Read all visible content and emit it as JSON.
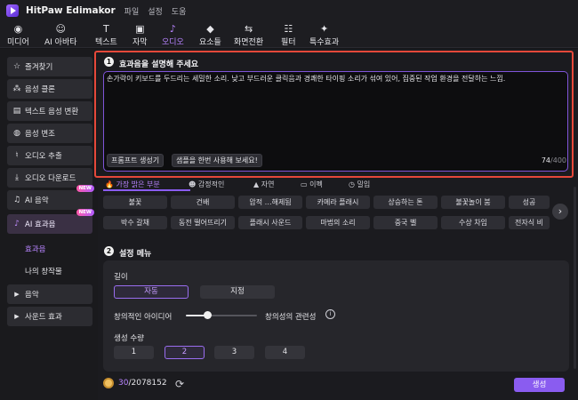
{
  "app": {
    "name": "HitPaw Edimakor",
    "menu": [
      "파일",
      "설정",
      "도움"
    ]
  },
  "toolbar": {
    "items": [
      {
        "label": "미디어",
        "icon": "media-icon"
      },
      {
        "label": "AI 아바타",
        "icon": "avatar-icon"
      },
      {
        "label": "텍스트",
        "icon": "text-icon"
      },
      {
        "label": "자막",
        "icon": "subtitle-icon"
      },
      {
        "label": "오디오",
        "icon": "audio-icon"
      },
      {
        "label": "요소들",
        "icon": "elements-icon"
      },
      {
        "label": "화면전환",
        "icon": "transition-icon"
      },
      {
        "label": "필터",
        "icon": "filter-icon"
      },
      {
        "label": "특수효과",
        "icon": "effects-icon"
      }
    ],
    "active": "오디오"
  },
  "sidebar": {
    "items": [
      {
        "label": "즐겨찾기",
        "icon": "star-icon"
      },
      {
        "label": "음성 클론",
        "icon": "voice-clone-icon"
      },
      {
        "label": "텍스트 음성 변환",
        "icon": "tts-icon"
      },
      {
        "label": "음성 변조",
        "icon": "voice-change-icon"
      },
      {
        "label": "오디오 추출",
        "icon": "mic-icon"
      },
      {
        "label": "오디오 다운로드",
        "icon": "download-icon"
      },
      {
        "label": "AI 음악",
        "icon": "music-icon",
        "badge": "NEW"
      },
      {
        "label": "AI 효과음",
        "icon": "sound-effect-icon",
        "badge": "NEW"
      }
    ],
    "subitems": [
      "효과음",
      "나의 창작물"
    ],
    "collapsed": [
      "음악",
      "사운드 효과"
    ]
  },
  "description": {
    "step": "1",
    "title": "효과음을 설명해 주세요",
    "text": "손가락이 키보드를 두드리는 세밀한 소리. 낮고 부드러운 클릭음과 경쾌한 타이핑 소리가 섞여 있어, 집중된 작업 환경을 전달하는 느낌.",
    "prompt_button": "프롬프트 생성기",
    "sample_button": "샘플을 한번 사용해 보세요!",
    "count": "74",
    "max": "/400"
  },
  "categories": {
    "tabs": [
      "가장 밝은 부분",
      "감정적인",
      "자연",
      "이펙",
      "밀입"
    ],
    "icons": [
      "fire-icon",
      "smile-icon",
      "tree-icon",
      "film-icon",
      "clock-icon"
    ],
    "chips_row1": [
      "불꽃",
      "건배",
      "압적 …해제됨",
      "카메라 플래시",
      "상승하는 톤",
      "불꽃놀이 붐",
      "성공"
    ],
    "chips_row2": [
      "박수 갈채",
      "동전 떨어뜨리기",
      "플래시 사운드",
      "마법의 소리",
      "중국 벨",
      "수상 차임",
      "전자식 비"
    ]
  },
  "settings": {
    "step": "2",
    "title": "설정 메뉴",
    "length_label": "길이",
    "length_options": [
      "자동",
      "지정"
    ],
    "length_selected": "자동",
    "slider_left": "창의적인 아이디어",
    "slider_right": "창의성의 관련성",
    "slider_value": 0.3,
    "count_label": "생성 수량",
    "count_options": [
      "1",
      "2",
      "3",
      "4"
    ],
    "count_selected": "2"
  },
  "footer": {
    "credits_used": "30",
    "credits_total": "/2078152",
    "generate": "생성"
  },
  "colors": {
    "accent": "#8a5cf0",
    "highlight_border": "#e5483a",
    "background": "#161619"
  }
}
